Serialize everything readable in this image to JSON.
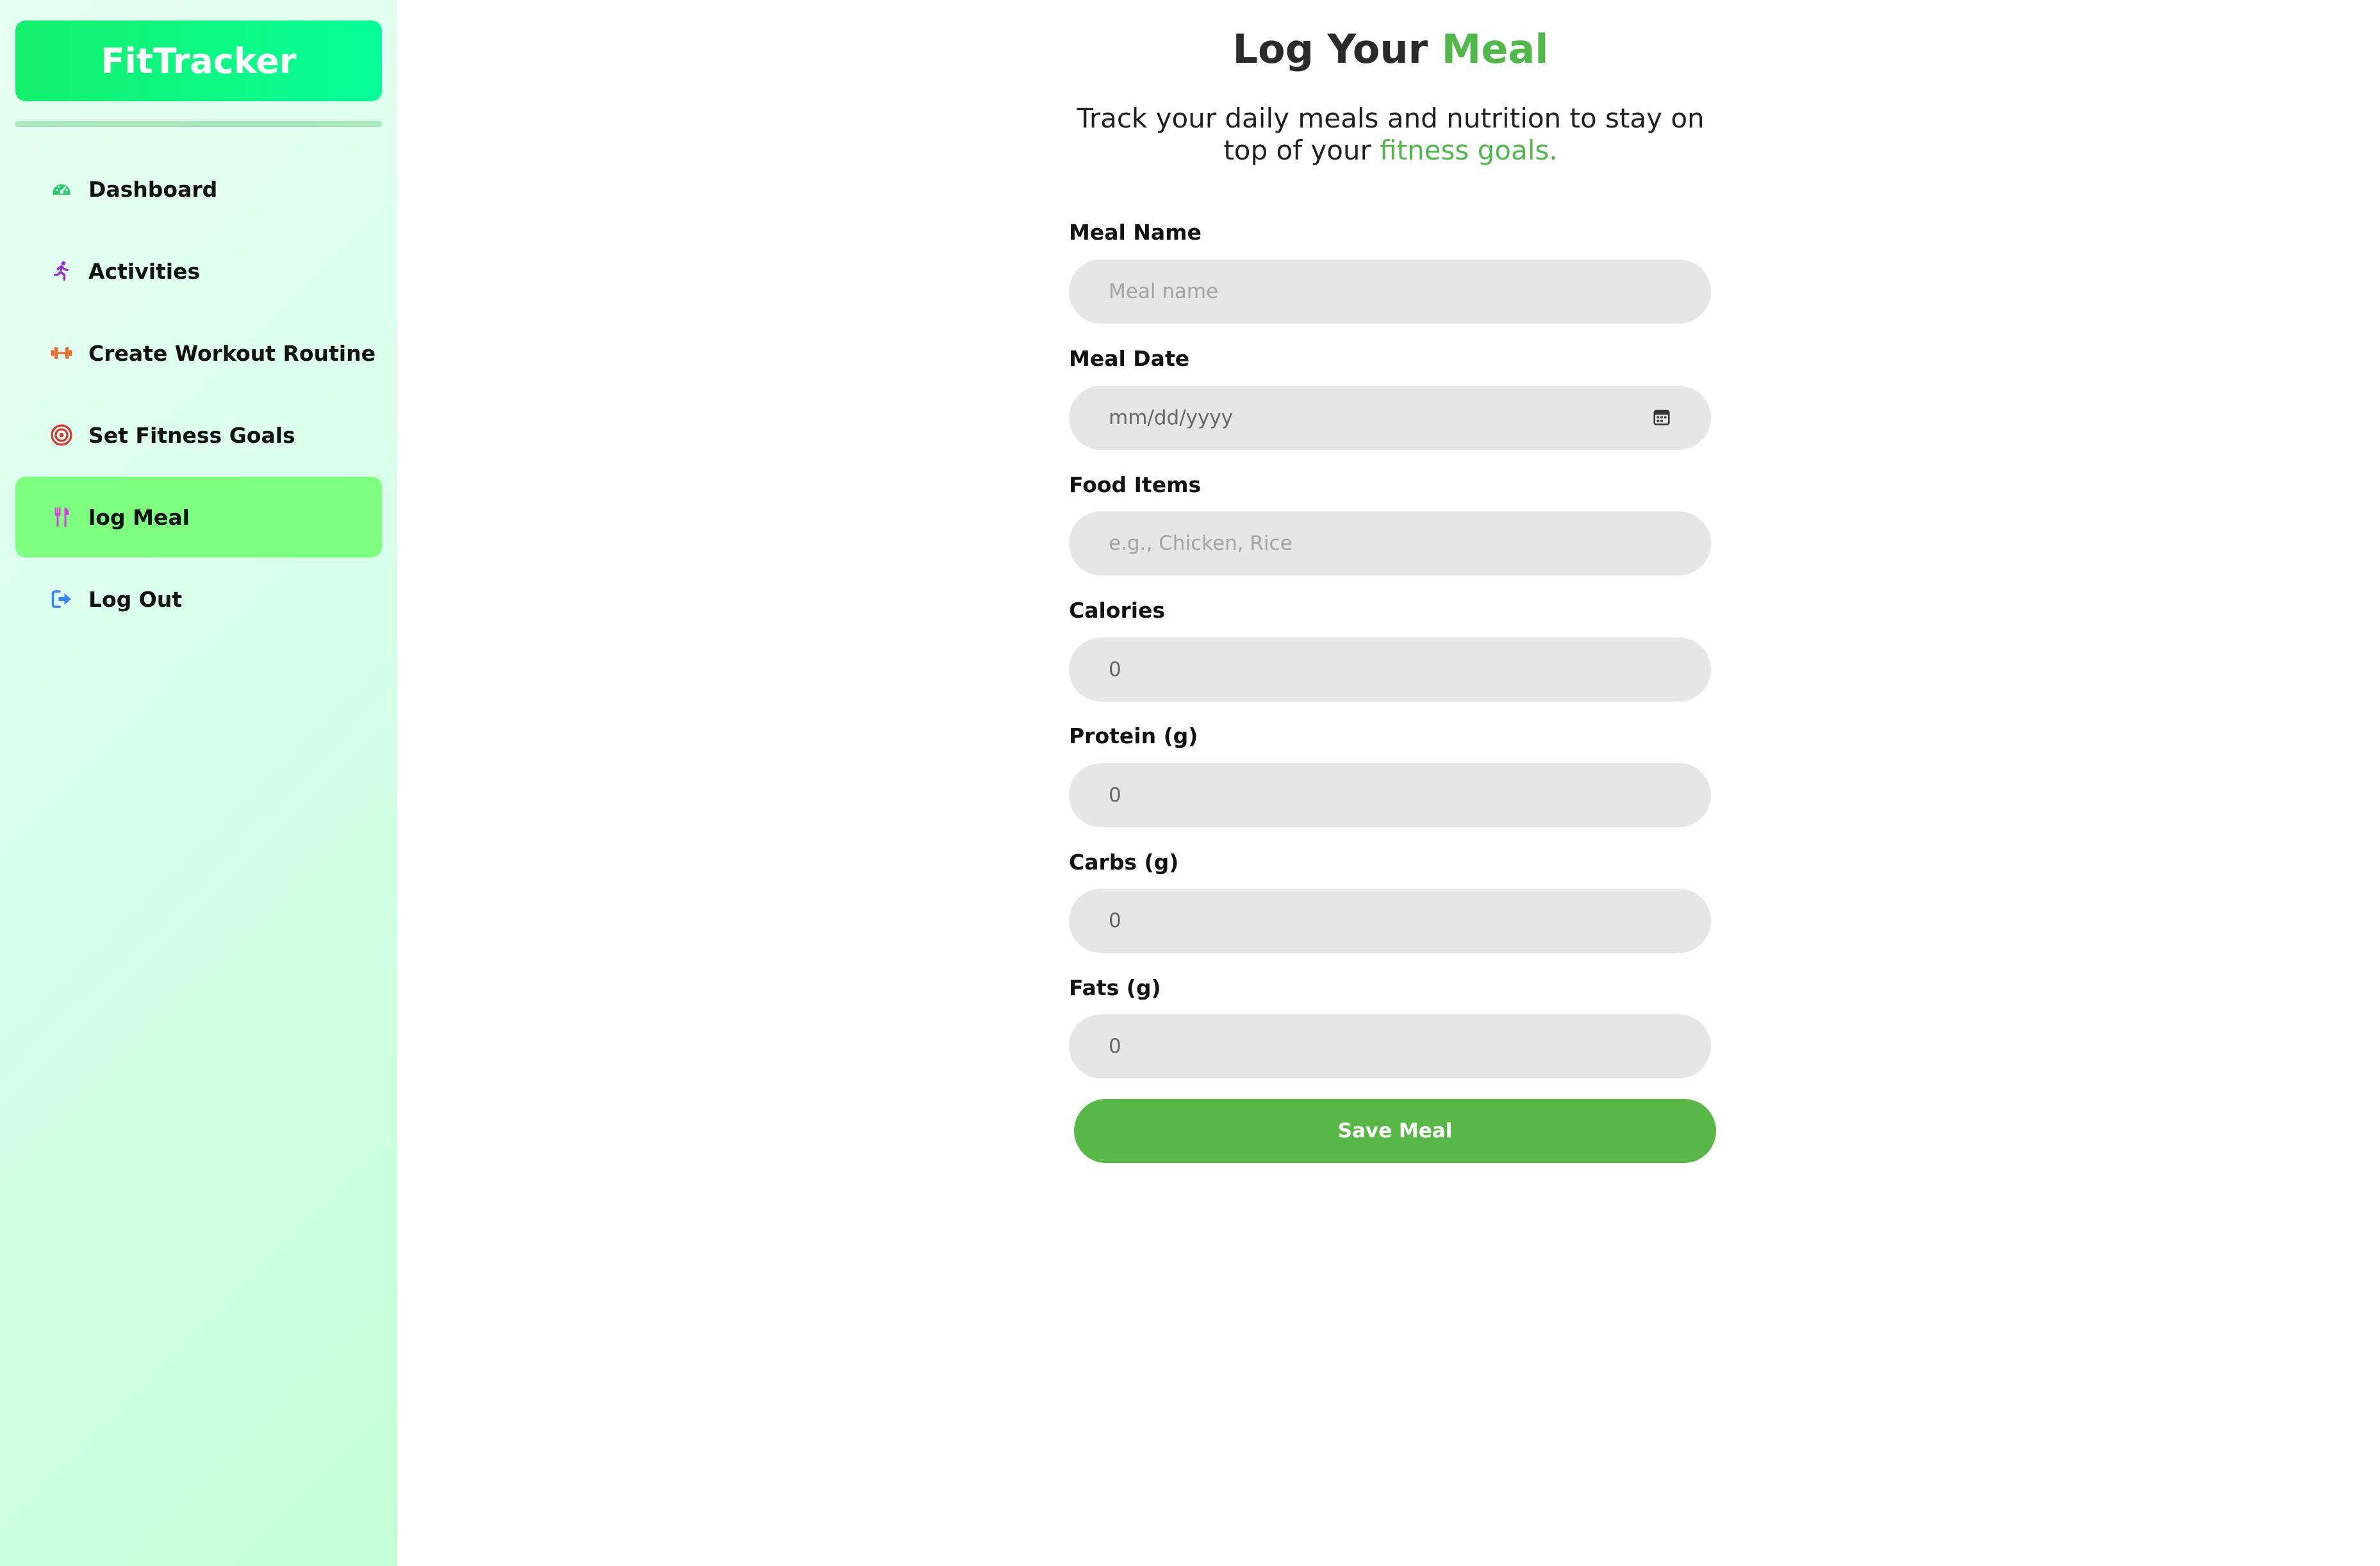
{
  "app": {
    "brand": "FitTracker"
  },
  "sidebar": {
    "items": [
      {
        "label": "Dashboard",
        "icon": "gauge-icon",
        "color": "#2ecc71"
      },
      {
        "label": "Activities",
        "icon": "running-person-icon",
        "color": "#8e2be2"
      },
      {
        "label": "Create Workout Routine",
        "icon": "dumbbell-icon",
        "color": "#f26522"
      },
      {
        "label": "Set Fitness Goals",
        "icon": "target-icon",
        "color": "#e0342f"
      },
      {
        "label": "log Meal",
        "icon": "utensils-icon",
        "color": "#d83fe0",
        "active": true
      },
      {
        "label": "Log Out",
        "icon": "sign-out-icon",
        "color": "#3b82f6"
      }
    ]
  },
  "header": {
    "title_prefix": "Log Your ",
    "title_accent": "Meal",
    "subtitle_prefix": "Track your daily meals and nutrition to stay on top of your ",
    "subtitle_accent": "fitness goals."
  },
  "form": {
    "meal_name": {
      "label": "Meal Name",
      "placeholder": "Meal name"
    },
    "meal_date": {
      "label": "Meal Date",
      "placeholder": "mm/dd/yyyy"
    },
    "food_items": {
      "label": "Food Items",
      "placeholder": "e.g., Chicken, Rice"
    },
    "calories": {
      "label": "Calories",
      "value": "0"
    },
    "protein": {
      "label": "Protein (g)",
      "value": "0"
    },
    "carbs": {
      "label": "Carbs (g)",
      "value": "0"
    },
    "fats": {
      "label": "Fats (g)",
      "value": "0"
    },
    "save_label": "Save Meal"
  },
  "colors": {
    "accent": "#4fb848",
    "button": "#57b846",
    "active_nav": "#7fff7f"
  }
}
